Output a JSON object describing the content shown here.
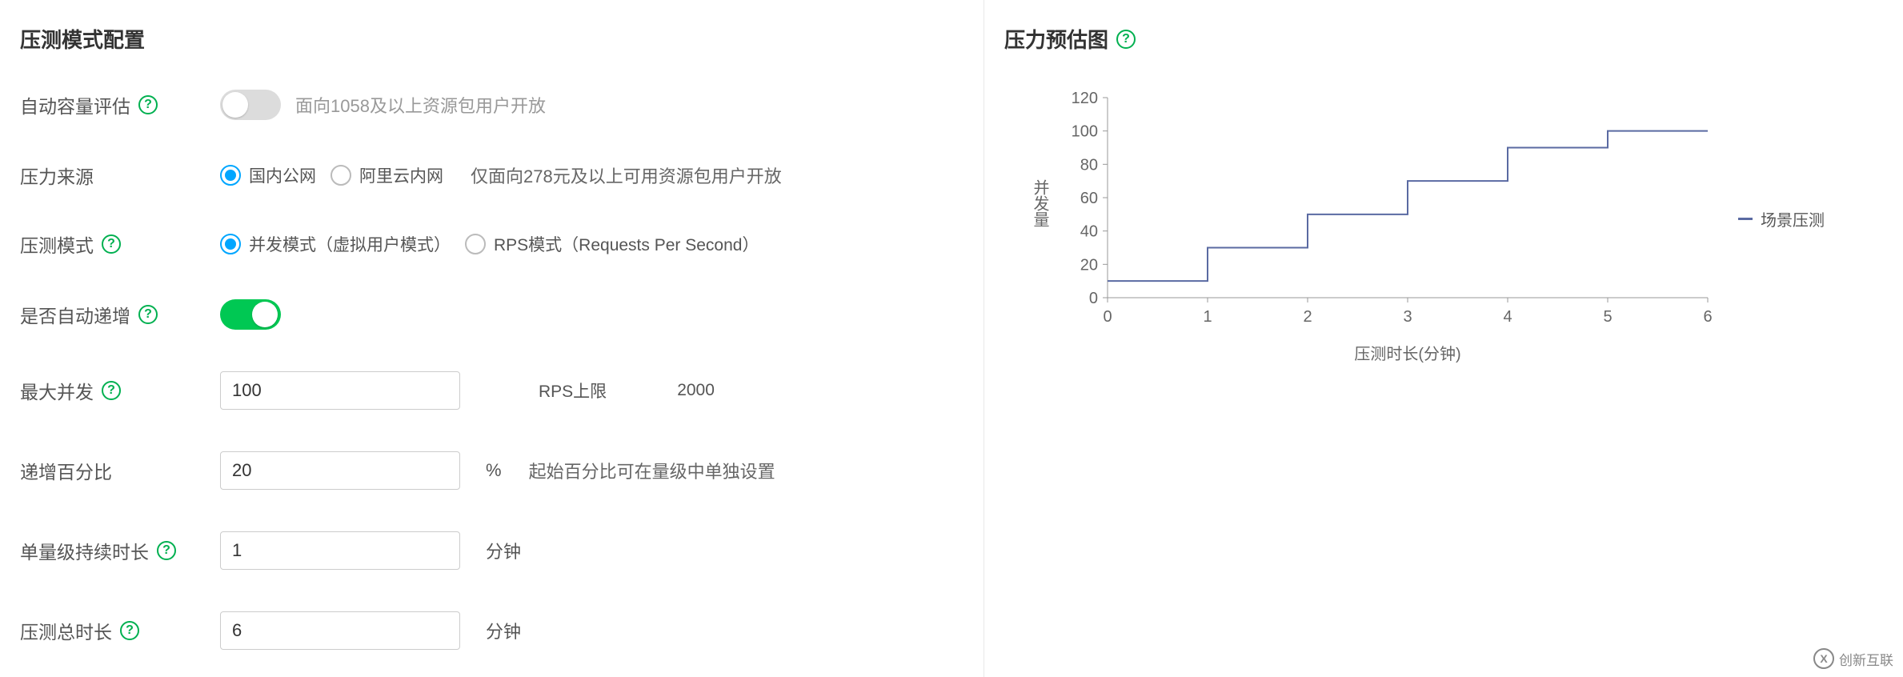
{
  "left": {
    "title": "压测模式配置",
    "rows": {
      "autoCapacity": {
        "label": "自动容量评估",
        "hint": "面向1058及以上资源包用户开放"
      },
      "source": {
        "label": "压力来源",
        "options": {
          "public": "国内公网",
          "internal": "阿里云内网"
        },
        "hint": "仅面向278元及以上可用资源包用户开放"
      },
      "mode": {
        "label": "压测模式",
        "options": {
          "concurrent": "并发模式（虚拟用户模式）",
          "rps": "RPS模式（Requests Per Second）"
        }
      },
      "autoInc": {
        "label": "是否自动递增"
      },
      "maxConc": {
        "label": "最大并发",
        "value": "100",
        "extraLabel": "RPS上限",
        "extraValue": "2000"
      },
      "incPercent": {
        "label": "递增百分比",
        "value": "20",
        "suffix": "%",
        "hint": "起始百分比可在量级中单独设置"
      },
      "stepDuration": {
        "label": "单量级持续时长",
        "value": "1",
        "suffix": "分钟"
      },
      "totalDuration": {
        "label": "压测总时长",
        "value": "6",
        "suffix": "分钟"
      }
    }
  },
  "right": {
    "title": "压力预估图",
    "ylabel": "并发量",
    "xlabel": "压测时长(分钟)",
    "legend": "场景压测"
  },
  "chart_data": {
    "type": "line",
    "title": "压力预估图",
    "xlabel": "压测时长(分钟)",
    "ylabel": "并发量",
    "step": true,
    "x": [
      0,
      1,
      1,
      2,
      2,
      3,
      3,
      4,
      4,
      5,
      5,
      6
    ],
    "y": [
      10,
      10,
      30,
      30,
      50,
      50,
      70,
      70,
      90,
      90,
      100,
      100
    ],
    "xlim": [
      0,
      6
    ],
    "ylim": [
      0,
      120
    ],
    "xticks": [
      0,
      1,
      2,
      3,
      4,
      5,
      6
    ],
    "yticks": [
      0,
      20,
      40,
      60,
      80,
      100,
      120
    ],
    "series": [
      {
        "name": "场景压测"
      }
    ]
  },
  "watermark": "创新互联"
}
